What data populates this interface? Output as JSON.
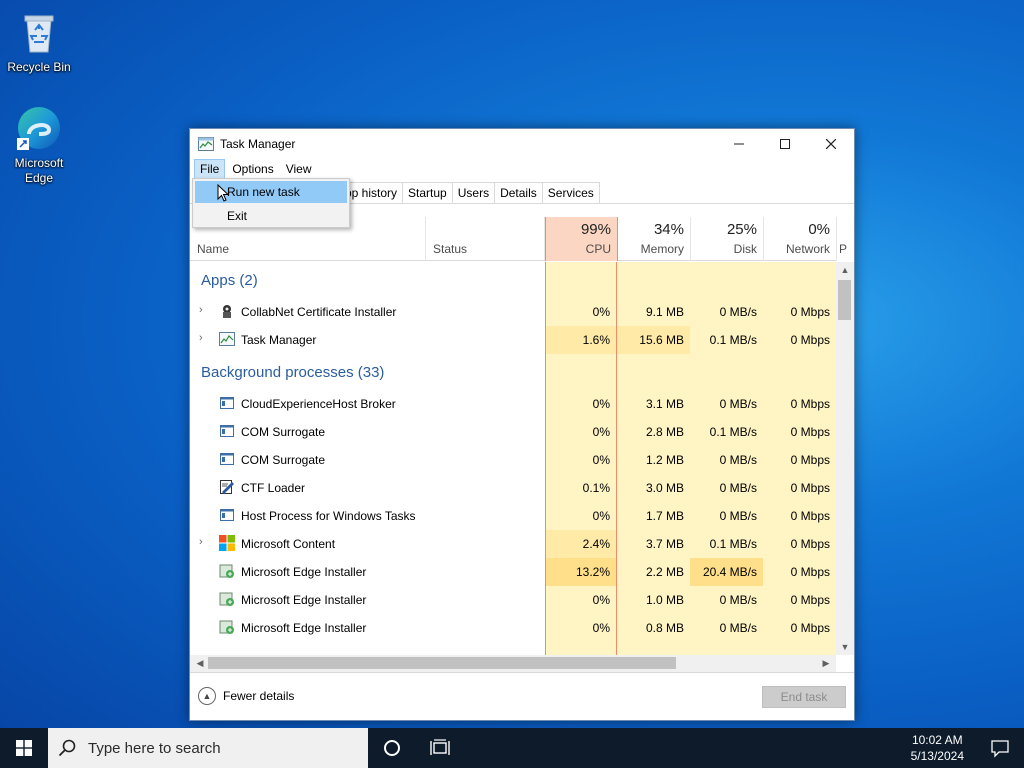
{
  "desktop": {
    "icons": [
      {
        "label": "Recycle Bin"
      },
      {
        "label": "Microsoft Edge"
      }
    ]
  },
  "window": {
    "title": "Task Manager",
    "menu": [
      "File",
      "Options",
      "View"
    ],
    "tabs": [
      "pp history",
      "Startup",
      "Users",
      "Details",
      "Services"
    ],
    "file_menu": {
      "items": [
        "Run new task",
        "Exit"
      ]
    },
    "columns": {
      "name": "Name",
      "status": "Status",
      "cpu": {
        "pct": "99%",
        "label": "CPU"
      },
      "memory": {
        "pct": "34%",
        "label": "Memory"
      },
      "disk": {
        "pct": "25%",
        "label": "Disk"
      },
      "network": {
        "pct": "0%",
        "label": "Network"
      },
      "power_partial": "P"
    },
    "groups": {
      "apps": "Apps (2)",
      "background": "Background processes (33)"
    },
    "apps": [
      {
        "name": "CollabNet Certificate Installer",
        "cpu": "0%",
        "memory": "9.1 MB",
        "disk": "0 MB/s",
        "network": "0 Mbps",
        "icon": "installer-icon"
      },
      {
        "name": "Task Manager",
        "cpu": "1.6%",
        "memory": "15.6 MB",
        "disk": "0.1 MB/s",
        "network": "0 Mbps",
        "icon": "task-manager-icon"
      }
    ],
    "background": [
      {
        "name": "CloudExperienceHost Broker",
        "cpu": "0%",
        "memory": "3.1 MB",
        "disk": "0 MB/s",
        "network": "0 Mbps",
        "icon": "window-app-icon"
      },
      {
        "name": "COM Surrogate",
        "cpu": "0%",
        "memory": "2.8 MB",
        "disk": "0.1 MB/s",
        "network": "0 Mbps",
        "icon": "window-app-icon"
      },
      {
        "name": "COM Surrogate",
        "cpu": "0%",
        "memory": "1.2 MB",
        "disk": "0 MB/s",
        "network": "0 Mbps",
        "icon": "window-app-icon"
      },
      {
        "name": "CTF Loader",
        "cpu": "0.1%",
        "memory": "3.0 MB",
        "disk": "0 MB/s",
        "network": "0 Mbps",
        "icon": "ctf-loader-icon"
      },
      {
        "name": "Host Process for Windows Tasks",
        "cpu": "0%",
        "memory": "1.7 MB",
        "disk": "0 MB/s",
        "network": "0 Mbps",
        "icon": "window-app-icon"
      },
      {
        "name": "Microsoft Content",
        "cpu": "2.4%",
        "memory": "3.7 MB",
        "disk": "0.1 MB/s",
        "network": "0 Mbps",
        "icon": "windows-logo-icon"
      },
      {
        "name": "Microsoft Edge Installer",
        "cpu": "13.2%",
        "memory": "2.2 MB",
        "disk": "20.4 MB/s",
        "network": "0 Mbps",
        "icon": "edge-installer-icon"
      },
      {
        "name": "Microsoft Edge Installer",
        "cpu": "0%",
        "memory": "1.0 MB",
        "disk": "0 MB/s",
        "network": "0 Mbps",
        "icon": "edge-installer-icon"
      },
      {
        "name": "Microsoft Edge Installer",
        "cpu": "0%",
        "memory": "0.8 MB",
        "disk": "0 MB/s",
        "network": "0 Mbps",
        "icon": "edge-installer-icon"
      }
    ],
    "footer": {
      "fewer_details": "Fewer details",
      "end_task": "End task"
    }
  },
  "taskbar": {
    "search_placeholder": "Type here to search",
    "time": "10:02 AM",
    "date": "5/13/2024"
  }
}
